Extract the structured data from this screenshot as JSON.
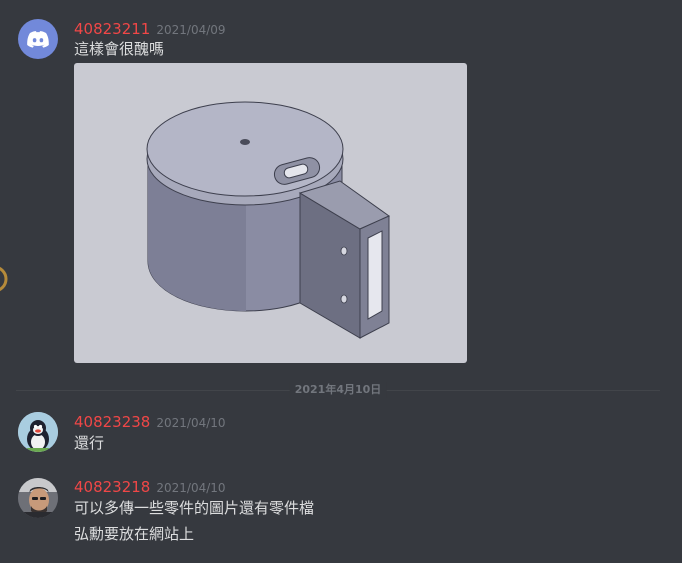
{
  "messages": [
    {
      "author": "40823211",
      "timestamp": "2021/04/09",
      "lines": [
        "這樣會很醜嗎"
      ],
      "avatar": "discord-logo-icon"
    },
    {
      "author": "40823238",
      "timestamp": "2021/04/10",
      "lines": [
        "還行"
      ],
      "avatar": "penguin-avatar"
    },
    {
      "author": "40823218",
      "timestamp": "2021/04/10",
      "lines": [
        "可以多傳一些零件的圖片還有零件檔",
        "弘勳要放在網站上"
      ],
      "avatar": "person-avatar"
    }
  ],
  "date_divider": "2021年4月10日",
  "colors": {
    "background": "#36393f",
    "username": "#f04747",
    "text": "#dcddde",
    "muted": "#72767d",
    "discord_blurple": "#7289da"
  }
}
